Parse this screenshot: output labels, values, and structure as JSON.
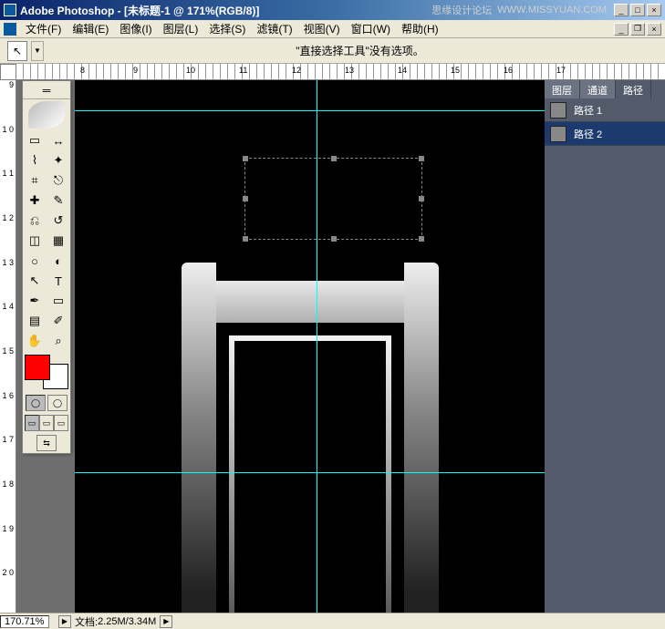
{
  "title": "Adobe Photoshop - [未标题-1 @ 171%(RGB/8)]",
  "watermark": "思缘设计论坛",
  "watermark_url": "WWW.MISSYUAN.COM",
  "menu": {
    "file": "文件(F)",
    "edit": "编辑(E)",
    "image": "图像(I)",
    "layer": "图层(L)",
    "select": "选择(S)",
    "filter": "滤镜(T)",
    "view": "视图(V)",
    "window": "窗口(W)",
    "help": "帮助(H)"
  },
  "options_message": "\"直接选择工具\"没有选项。",
  "ruler_h": {
    "t8": "8",
    "t9": "9",
    "t10": "10",
    "t11": "11",
    "t12": "12",
    "t13": "13",
    "t14": "14",
    "t15": "15",
    "t16": "16",
    "t17": "17"
  },
  "ruler_v": {
    "n9": "9",
    "n10": "1\n0",
    "n11": "1\n1",
    "n12": "1\n2",
    "n13": "1\n3",
    "n14": "1\n4",
    "n15": "1\n5",
    "n16": "1\n6",
    "n17": "1\n7",
    "n18": "1\n8",
    "n19": "1\n9",
    "n20": "2\n0"
  },
  "colors": {
    "fg": "#ff0000",
    "bg": "#ffffff"
  },
  "panel": {
    "tab_layers": "图层",
    "tab_channels": "通道",
    "tab_paths": "路径",
    "path1": "路径 1",
    "path2": "路径 2"
  },
  "status": {
    "zoom": "170.71%",
    "doc_label": "文档:",
    "doc_size": "2.25M/3.34M"
  },
  "tools": {
    "marquee": "▭",
    "move": "↔",
    "lasso": "⌇",
    "wand": "✦",
    "crop": "⌗",
    "slice": "⎋",
    "heal": "✚",
    "brush": "✎",
    "stamp": "⎌",
    "history": "↺",
    "eraser": "◫",
    "gradient": "▦",
    "blur": "○",
    "dodge": "◐",
    "path-sel": "↖",
    "type": "T",
    "pen": "✒",
    "shape": "▭",
    "notes": "▤",
    "eyedrop": "✐",
    "hand": "✋",
    "zoom": "⌕"
  }
}
